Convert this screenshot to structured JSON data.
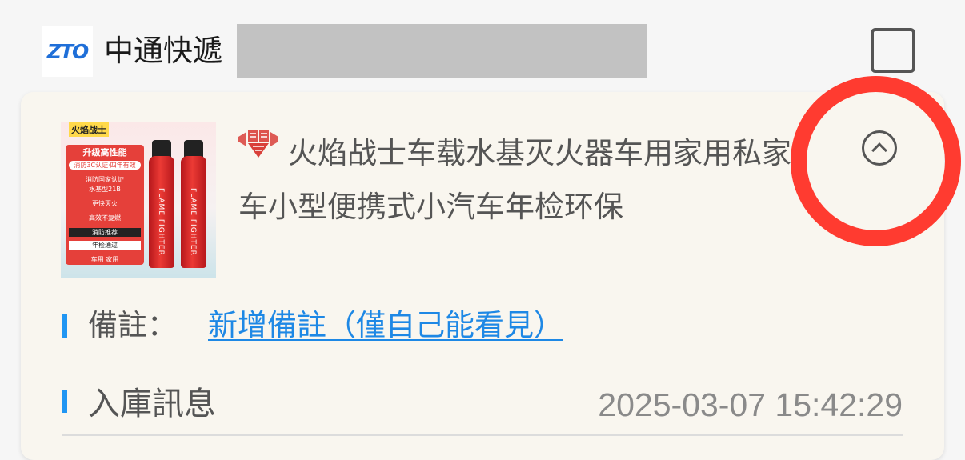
{
  "header": {
    "courier_logo_text": "ZTO",
    "courier_name": "中通快遞"
  },
  "product": {
    "title": "火焰战士车载水基灭火器车用家用私家车小型便携式小汽车年检环保",
    "shop_icon": "tmall-shop-icon",
    "thumbnail": {
      "brand": "火焰战士",
      "lines": [
        "升级高性能",
        "消防3C认证·四年有效",
        "消防国家认证",
        "水基型21B",
        "更快灭火",
        "高效不复燃",
        "消防推荐",
        "年检通过",
        "车用  家用"
      ],
      "can_label": "FLAME FIGHTER"
    }
  },
  "note": {
    "label": "備註：",
    "link_text": "新增備註（僅自己能看見）"
  },
  "storage": {
    "label": "入庫訊息",
    "timestamp": "2025-03-07 15:42:29"
  },
  "colors": {
    "accent_blue": "#2196f3",
    "link_blue": "#1e88e5",
    "annotation_red": "#ff3b30",
    "card_bg": "#f9f6ef",
    "page_bg": "#f6f6f6"
  }
}
